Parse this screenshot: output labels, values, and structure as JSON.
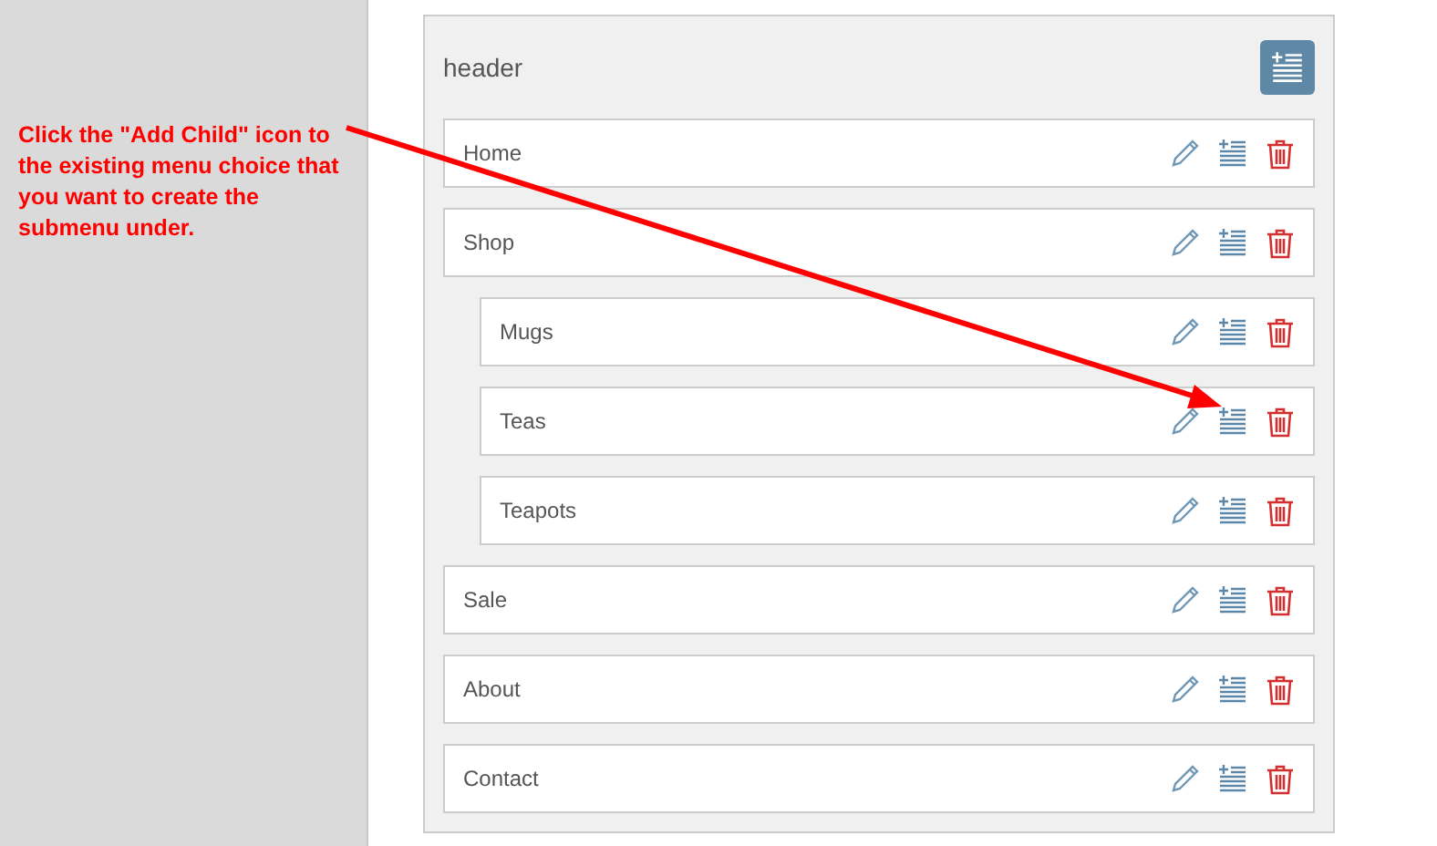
{
  "annotation": "Click the \"Add Child\" icon to the existing menu choice that you want to create the submenu under.",
  "panel": {
    "title": "header"
  },
  "items": [
    {
      "label": "Home"
    },
    {
      "label": "Shop",
      "children": [
        {
          "label": "Mugs"
        },
        {
          "label": "Teas"
        },
        {
          "label": "Teapots"
        }
      ]
    },
    {
      "label": "Sale"
    },
    {
      "label": "About"
    },
    {
      "label": "Contact"
    }
  ]
}
